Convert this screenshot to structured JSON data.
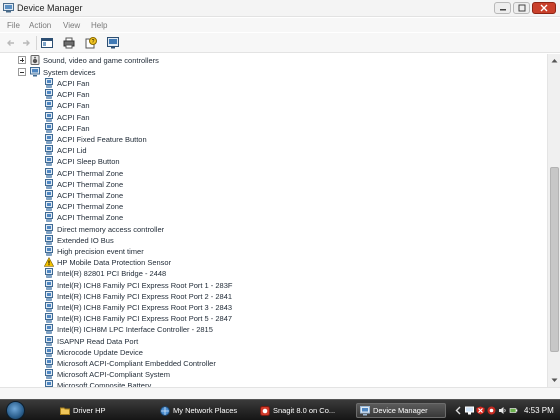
{
  "window": {
    "title": "Device Manager"
  },
  "menu": [
    "File",
    "Action",
    "View",
    "Help"
  ],
  "tree": {
    "categories": [
      {
        "label": "Sound, video and game controllers",
        "expanded": false
      },
      {
        "label": "System devices",
        "expanded": true
      }
    ],
    "devices": [
      {
        "label": "ACPI Fan"
      },
      {
        "label": "ACPI Fan"
      },
      {
        "label": "ACPI Fan"
      },
      {
        "label": "ACPI Fan"
      },
      {
        "label": "ACPI Fan"
      },
      {
        "label": "ACPI Fixed Feature Button"
      },
      {
        "label": "ACPI Lid"
      },
      {
        "label": "ACPI Sleep Button"
      },
      {
        "label": "ACPI Thermal Zone"
      },
      {
        "label": "ACPI Thermal Zone"
      },
      {
        "label": "ACPI Thermal Zone"
      },
      {
        "label": "ACPI Thermal Zone"
      },
      {
        "label": "ACPI Thermal Zone"
      },
      {
        "label": "Direct memory access controller"
      },
      {
        "label": "Extended IO Bus"
      },
      {
        "label": "High precision event timer"
      },
      {
        "label": "HP Mobile Data Protection Sensor",
        "warning": true
      },
      {
        "label": "Intel(R) 82801 PCI Bridge - 2448"
      },
      {
        "label": "Intel(R) ICH8 Family PCI Express Root Port 1 - 283F"
      },
      {
        "label": "Intel(R) ICH8 Family PCI Express Root Port 2 - 2841"
      },
      {
        "label": "Intel(R) ICH8 Family PCI Express Root Port 3 - 2843"
      },
      {
        "label": "Intel(R) ICH8 Family PCI Express Root Port 5 - 2847"
      },
      {
        "label": "Intel(R) ICH8M LPC Interface Controller - 2815"
      },
      {
        "label": "ISAPNP Read Data Port"
      },
      {
        "label": "Microcode Update Device"
      },
      {
        "label": "Microsoft ACPI-Compliant Embedded Controller"
      },
      {
        "label": "Microsoft ACPI-Compliant System"
      },
      {
        "label": "Microsoft Composite Battery"
      }
    ]
  },
  "taskbar": {
    "tasks": [
      {
        "label": "Driver HP",
        "icon": "folder-icon",
        "active": false
      },
      {
        "label": "My Network Places",
        "icon": "network-icon",
        "active": false
      },
      {
        "label": "Snagit 8.0 on Co...",
        "icon": "snagit-icon",
        "active": false
      },
      {
        "label": "Device Manager",
        "icon": "device-manager-icon",
        "active": true
      }
    ],
    "clock": "4:53 PM"
  },
  "colors": {
    "accent": "#2b5f8d",
    "close": "#c9402b",
    "warning": "#f5c400"
  }
}
